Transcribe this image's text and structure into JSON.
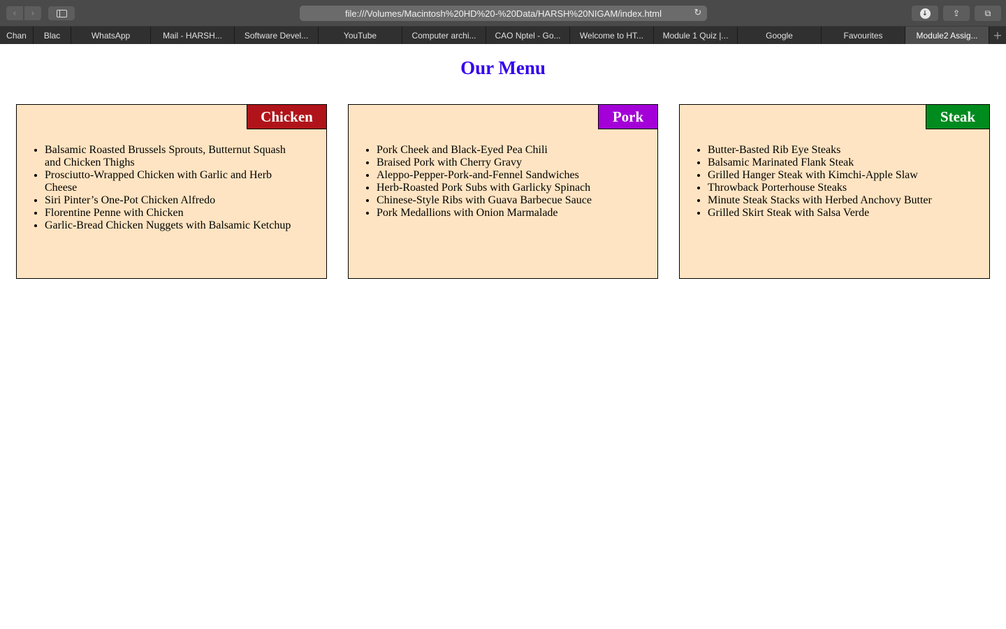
{
  "browser": {
    "url": "file:///Volumes/Macintosh%20HD%20-%20Data/HARSH%20NIGAM/index.html",
    "tabs": [
      {
        "label": "Chan",
        "active": false
      },
      {
        "label": "Blac",
        "active": false
      },
      {
        "label": "WhatsApp",
        "active": false
      },
      {
        "label": "Mail - HARSH...",
        "active": false
      },
      {
        "label": "Software Devel...",
        "active": false
      },
      {
        "label": "YouTube",
        "active": false
      },
      {
        "label": "Computer archi...",
        "active": false
      },
      {
        "label": "CAO Nptel - Go...",
        "active": false
      },
      {
        "label": "Welcome to HT...",
        "active": false
      },
      {
        "label": "Module 1 Quiz |...",
        "active": false
      },
      {
        "label": "Google",
        "active": false
      },
      {
        "label": "Favourites",
        "active": false
      },
      {
        "label": "Module2 Assig...",
        "active": true
      }
    ]
  },
  "page": {
    "title": "Our Menu",
    "title_color": "#3300ee",
    "card_background": "#fee4c2",
    "sections": [
      {
        "label": "Chicken",
        "color": "#b0141a",
        "items": [
          "Balsamic Roasted Brussels Sprouts, Butternut Squash and Chicken Thighs",
          "Prosciutto-Wrapped Chicken with Garlic and Herb Cheese",
          "Siri Pinter’s One-Pot Chicken Alfredo",
          "Florentine Penne with Chicken",
          "Garlic-Bread Chicken Nuggets with Balsamic Ketchup"
        ]
      },
      {
        "label": "Pork",
        "color": "#a400d8",
        "items": [
          "Pork Cheek and Black-Eyed Pea Chili",
          "Braised Pork with Cherry Gravy",
          "Aleppo-Pepper-Pork-and-Fennel Sandwiches",
          "Herb-Roasted Pork Subs with Garlicky Spinach",
          "Chinese-Style Ribs with Guava Barbecue Sauce",
          "Pork Medallions with Onion Marmalade"
        ]
      },
      {
        "label": "Steak",
        "color": "#008b1f",
        "items": [
          "Butter-Basted Rib Eye Steaks",
          "Balsamic Marinated Flank Steak",
          "Grilled Hanger Steak with Kimchi-Apple Slaw",
          "Throwback Porterhouse Steaks",
          "Minute Steak Stacks with Herbed Anchovy Butter",
          "Grilled Skirt Steak with Salsa Verde"
        ]
      }
    ]
  }
}
